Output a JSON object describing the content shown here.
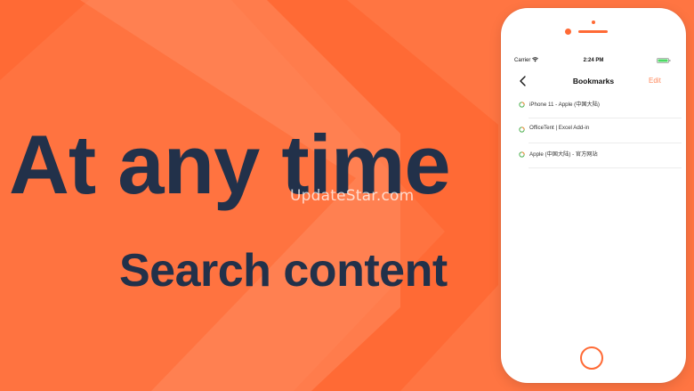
{
  "promo": {
    "headline": "At any time",
    "subline": "Search content",
    "watermark": "UpdateStar.com"
  },
  "colors": {
    "background": "#ff6a35",
    "headline_text": "#22314a",
    "accent": "#ff6a35",
    "edit_text": "#ff8a5e",
    "battery": "#4cd964",
    "globe_green": "#4caf50",
    "globe_orange": "#ff8a3d"
  },
  "phone": {
    "status_bar": {
      "carrier": "Carrier",
      "wifi_icon": "wifi-icon",
      "time": "2:24 PM",
      "battery_icon": "battery-icon"
    },
    "nav_bar": {
      "back_icon": "chevron-left-icon",
      "title": "Bookmarks",
      "edit_label": "Edit"
    },
    "bookmarks": [
      {
        "icon": "globe-icon",
        "title": "iPhone 11 - Apple (中国大陆)"
      },
      {
        "icon": "globe-icon",
        "title": "OfficeTent | Excel Add-in"
      },
      {
        "icon": "globe-icon",
        "title": "Apple (中国大陆) - 官方网站"
      }
    ],
    "home_button": "home-button"
  }
}
